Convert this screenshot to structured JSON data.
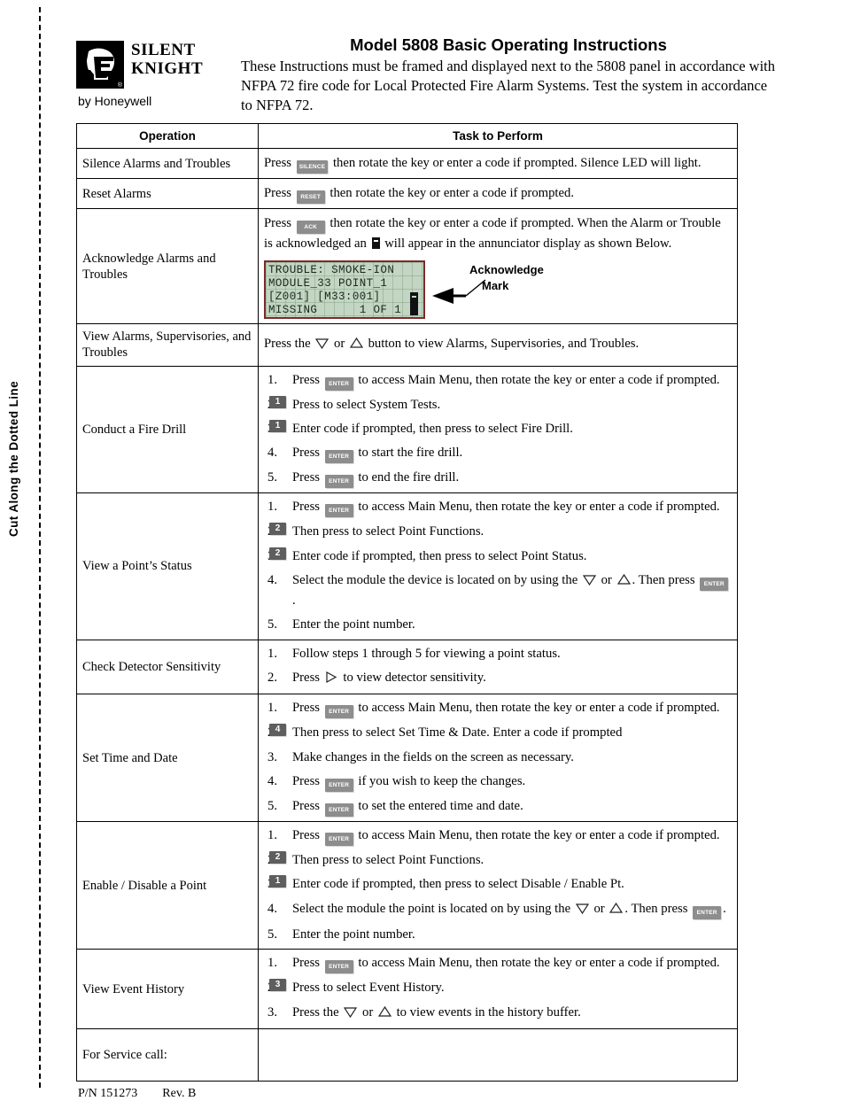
{
  "cut_strip": {
    "label": "Cut Along the Dotted Line"
  },
  "brand": {
    "line1": "SILENT",
    "line2": "KNIGHT",
    "registered": "®",
    "subtitle": "by Honeywell",
    "logo_icon": "knight-helmet-icon"
  },
  "header": {
    "title": "Model 5808 Basic Operating Instructions",
    "subtitle": "These Instructions must be framed and displayed next to the 5808 panel in accordance with NFPA 72 fire code for Local Protected Fire Alarm Systems. Test the system in accordance to NFPA 72."
  },
  "table": {
    "columns": [
      "Operation",
      "Task to Perform"
    ],
    "rows": [
      {
        "operation": "Silence Alarms and Troubles",
        "segments": [
          {
            "t": "text",
            "v": "Press "
          },
          {
            "t": "key",
            "v": "SILENCE"
          },
          {
            "t": "text",
            "v": " then rotate the key or enter a code if prompted. Silence LED will light."
          }
        ]
      },
      {
        "operation": "Reset Alarms",
        "segments": [
          {
            "t": "text",
            "v": "Press "
          },
          {
            "t": "key",
            "v": "RESET"
          },
          {
            "t": "text",
            "v": " then rotate the key or enter a code if prompted."
          }
        ]
      },
      {
        "operation": "Acknowledge Alarms and Troubles",
        "segments": [
          {
            "t": "text",
            "v": "Press "
          },
          {
            "t": "key",
            "v": "ACK"
          },
          {
            "t": "text",
            "v": " then rotate the key or enter a code if prompted. When the Alarm or Trouble is acknowledged an "
          },
          {
            "t": "ackmark",
            "v": "acknowledge-mark"
          },
          {
            "t": "text",
            "v": " will appear in the annunciator display as shown Below."
          }
        ],
        "lcd": {
          "lines": [
            "TROUBLE: SMOKE-ION",
            "MODULE_33 POINT_1",
            "[Z001] [M33:001]",
            "MISSING      1 OF 1"
          ],
          "callout_line1": "Acknowledge",
          "callout_line2": "Mark"
        }
      },
      {
        "operation": "View Alarms, Supervisories, and Troubles",
        "segments": [
          {
            "t": "text",
            "v": "Press the "
          },
          {
            "t": "tri",
            "v": "down"
          },
          {
            "t": "text",
            "v": " or "
          },
          {
            "t": "tri",
            "v": "up"
          },
          {
            "t": "text",
            "v": " button to view Alarms, Supervisories, and Troubles."
          }
        ]
      },
      {
        "operation": "Conduct a Fire Drill",
        "steps": [
          [
            {
              "t": "text",
              "v": "Press "
            },
            {
              "t": "key",
              "v": "ENTER"
            },
            {
              "t": "text",
              "v": " to access Main Menu, then rotate the key or enter a code if prompted."
            }
          ],
          [
            {
              "t": "text",
              "v": "Press "
            },
            {
              "t": "num",
              "v": "1"
            },
            {
              "t": "text",
              "v": " to select System Tests."
            }
          ],
          [
            {
              "t": "text",
              "v": "Enter code if prompted, then press "
            },
            {
              "t": "num",
              "v": "1"
            },
            {
              "t": "text",
              "v": " to select Fire Drill."
            }
          ],
          [
            {
              "t": "text",
              "v": "Press "
            },
            {
              "t": "key",
              "v": "ENTER"
            },
            {
              "t": "text",
              "v": " to start the fire drill."
            }
          ],
          [
            {
              "t": "text",
              "v": "Press "
            },
            {
              "t": "key",
              "v": "ENTER"
            },
            {
              "t": "text",
              "v": " to end the fire drill."
            }
          ]
        ]
      },
      {
        "operation": "View a Point’s Status",
        "steps": [
          [
            {
              "t": "text",
              "v": "Press "
            },
            {
              "t": "key",
              "v": "ENTER"
            },
            {
              "t": "text",
              "v": " to access Main Menu, then rotate the key or enter a code if prompted."
            }
          ],
          [
            {
              "t": "text",
              "v": "Then press "
            },
            {
              "t": "num",
              "v": "2"
            },
            {
              "t": "text",
              "v": " to select Point Functions."
            }
          ],
          [
            {
              "t": "text",
              "v": "Enter code if prompted, then press "
            },
            {
              "t": "num",
              "v": "2"
            },
            {
              "t": "text",
              "v": " to select Point Status."
            }
          ],
          [
            {
              "t": "text",
              "v": "Select the module the device is located on by using the "
            },
            {
              "t": "tri",
              "v": "down"
            },
            {
              "t": "text",
              "v": " or "
            },
            {
              "t": "tri",
              "v": "up"
            },
            {
              "t": "text",
              "v": ". Then press "
            },
            {
              "t": "key",
              "v": "ENTER"
            },
            {
              "t": "text",
              "v": "."
            }
          ],
          [
            {
              "t": "text",
              "v": "Enter the point number."
            }
          ]
        ]
      },
      {
        "operation": "Check Detector Sensitivity",
        "steps": [
          [
            {
              "t": "text",
              "v": "Follow steps 1 through 5 for viewing a point status."
            }
          ],
          [
            {
              "t": "text",
              "v": "Press "
            },
            {
              "t": "tri",
              "v": "right"
            },
            {
              "t": "text",
              "v": " to view detector sensitivity."
            }
          ]
        ]
      },
      {
        "operation": "Set Time and Date",
        "steps": [
          [
            {
              "t": "text",
              "v": "Press "
            },
            {
              "t": "key",
              "v": "ENTER"
            },
            {
              "t": "text",
              "v": " to access Main Menu, then rotate the key or enter a code if prompted."
            }
          ],
          [
            {
              "t": "text",
              "v": "Then press "
            },
            {
              "t": "num",
              "v": "4"
            },
            {
              "t": "text",
              "v": " to select Set Time & Date. Enter a code if prompted"
            }
          ],
          [
            {
              "t": "text",
              "v": "Make changes in the fields on the screen as necessary."
            }
          ],
          [
            {
              "t": "text",
              "v": "Press "
            },
            {
              "t": "key",
              "v": "ENTER"
            },
            {
              "t": "text",
              "v": " if you wish to keep the changes."
            }
          ],
          [
            {
              "t": "text",
              "v": "Press "
            },
            {
              "t": "key",
              "v": "ENTER"
            },
            {
              "t": "text",
              "v": " to set the entered time and date."
            }
          ]
        ]
      },
      {
        "operation": "Enable / Disable a Point",
        "steps": [
          [
            {
              "t": "text",
              "v": "Press "
            },
            {
              "t": "key",
              "v": "ENTER"
            },
            {
              "t": "text",
              "v": " to access Main Menu, then rotate the key or enter a code if prompted."
            }
          ],
          [
            {
              "t": "text",
              "v": "Then press "
            },
            {
              "t": "num",
              "v": "2"
            },
            {
              "t": "text",
              "v": " to select Point Functions."
            }
          ],
          [
            {
              "t": "text",
              "v": "Enter code if prompted, then press "
            },
            {
              "t": "num",
              "v": "1"
            },
            {
              "t": "text",
              "v": " to select Disable / Enable Pt."
            }
          ],
          [
            {
              "t": "text",
              "v": "Select the module the point is located on by using the "
            },
            {
              "t": "tri",
              "v": "down"
            },
            {
              "t": "text",
              "v": " or "
            },
            {
              "t": "tri",
              "v": "up"
            },
            {
              "t": "text",
              "v": ". Then press "
            },
            {
              "t": "key",
              "v": "ENTER"
            },
            {
              "t": "text",
              "v": "."
            }
          ],
          [
            {
              "t": "text",
              "v": "Enter the point number."
            }
          ]
        ]
      },
      {
        "operation": "View Event History",
        "steps": [
          [
            {
              "t": "text",
              "v": "Press "
            },
            {
              "t": "key",
              "v": "ENTER"
            },
            {
              "t": "text",
              "v": " to access Main Menu, then rotate the key or enter a code if prompted."
            }
          ],
          [
            {
              "t": "text",
              "v": "Press "
            },
            {
              "t": "num",
              "v": "3"
            },
            {
              "t": "text",
              "v": " to select Event History."
            }
          ],
          [
            {
              "t": "text",
              "v": "Press the "
            },
            {
              "t": "tri",
              "v": "down"
            },
            {
              "t": "text",
              "v": " or "
            },
            {
              "t": "tri",
              "v": "up"
            },
            {
              "t": "text",
              "v": " to view events in the history buffer."
            }
          ]
        ]
      },
      {
        "operation": "For Service call:",
        "segments": []
      }
    ]
  },
  "footer": {
    "part_number": "P/N 151273",
    "revision": "Rev. B"
  }
}
